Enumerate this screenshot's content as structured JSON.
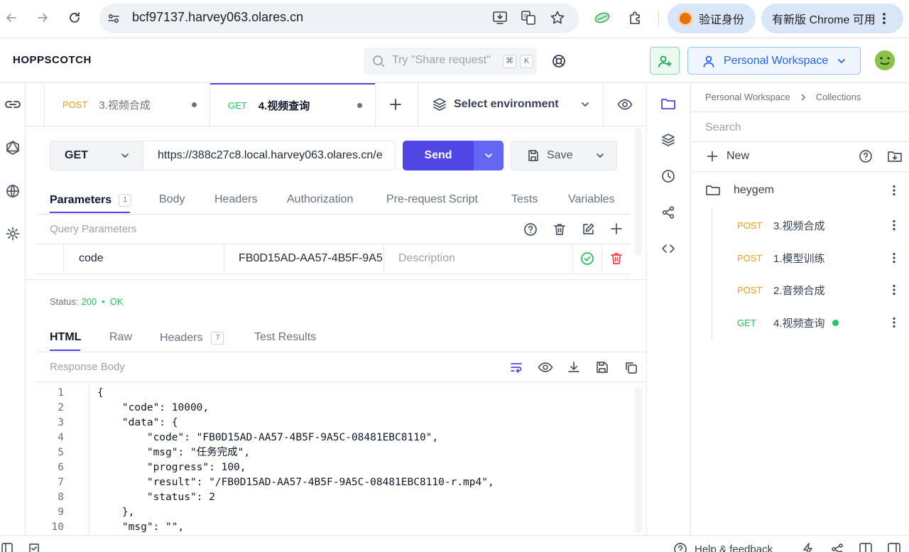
{
  "browser": {
    "url": "bcf97137.harvey063.olares.cn",
    "verify_label": "验证身份",
    "update_label": "有新版 Chrome 可用"
  },
  "header": {
    "brand": "HOPPSCOTCH",
    "search_placeholder": "Try \"Share request\"",
    "kbd1": "⌘",
    "kbd2": "K",
    "workspace_label": "Personal Workspace"
  },
  "tabs": [
    {
      "method": "POST",
      "name": "3.视频合成"
    },
    {
      "method": "GET",
      "name": "4.视频查询"
    }
  ],
  "environment": {
    "label": "Select environment"
  },
  "request": {
    "method": "GET",
    "url": "https://388c27c8.local.harvey063.olares.cn/e",
    "send_label": "Send",
    "save_label": "Save"
  },
  "request_tabs": {
    "parameters": "Parameters",
    "parameters_count": "1",
    "body": "Body",
    "headers": "Headers",
    "authorization": "Authorization",
    "prerequest": "Pre-request Script",
    "tests": "Tests",
    "variables": "Variables"
  },
  "query": {
    "label": "Query Parameters",
    "param_key": "code",
    "param_value": "FB0D15AD-AA57-4B5F-9A5",
    "param_desc_placeholder": "Description"
  },
  "response": {
    "status_label": "Status:",
    "status_code": "200",
    "status_sep": "•",
    "status_text": "OK",
    "tabs": {
      "html": "HTML",
      "raw": "Raw",
      "headers": "Headers",
      "headers_count": "7",
      "test_results": "Test Results"
    },
    "body_label": "Response Body",
    "lines": [
      "{",
      "    \"code\": 10000,",
      "    \"data\": {",
      "        \"code\": \"FB0D15AD-AA57-4B5F-9A5C-08481EBC8110\",",
      "        \"msg\": \"任务完成\",",
      "        \"progress\": 100,",
      "        \"result\": \"/FB0D15AD-AA57-4B5F-9A5C-08481EBC8110-r.mp4\",",
      "        \"status\": 2",
      "    },",
      "    \"msg\": \"\","
    ],
    "line_numbers": [
      "1",
      "2",
      "3",
      "4",
      "5",
      "6",
      "7",
      "8",
      "9",
      "10"
    ]
  },
  "sidebar": {
    "breadcrumb_root": "Personal Workspace",
    "breadcrumb_sep": ">",
    "breadcrumb_leaf": "Collections",
    "search_placeholder": "Search",
    "new_label": "New",
    "collection_name": "heygem",
    "requests": [
      {
        "method": "POST",
        "name": "3.视频合成"
      },
      {
        "method": "POST",
        "name": "1.模型训练"
      },
      {
        "method": "POST",
        "name": "2.音频合成"
      },
      {
        "method": "GET",
        "name": "4.视频查询"
      }
    ]
  },
  "footer": {
    "help_label": "Help & feedback"
  },
  "colors": {
    "accent": "#4f46e5",
    "post": "#f59e0b",
    "get": "#22c55e",
    "danger": "#ef4444"
  }
}
